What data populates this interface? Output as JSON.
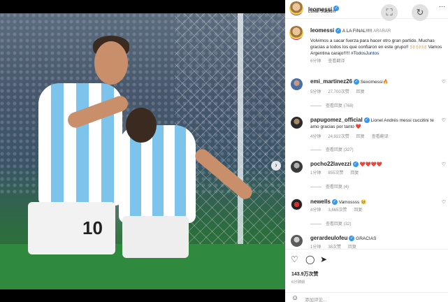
{
  "post": {
    "author": "leomessi",
    "location": "Lusail Stadium",
    "caption_head": "A LA FINAL!!!!! ",
    "caption_tag": "ARARAR",
    "caption_body": "Volvimos a sacar fuerza para hacer otro gran partido. Muchas gracias a todos los que confiaron en este grupo!! 🙌🏻🙌🏻🙌🏻 Vamos Argentina carajo!!!!! ",
    "hashtag": "#TodosJuntos",
    "caption_time": "6分钟",
    "caption_translate": "查看翻译",
    "likes": "143.9万次赞",
    "posted": "6分钟前",
    "jersey_number": "10",
    "add_comment_placeholder": "添加评论..."
  },
  "comments": [
    {
      "user": "emi_martinez26",
      "verified": true,
      "text": "Sexomessi🔥",
      "time": "5分钟",
      "likes": "27,700次赞",
      "reply": "回复",
      "view_replies": "查看回复 (768)"
    },
    {
      "user": "papugomez_official",
      "verified": true,
      "text": "Lionel Andrés messi cuccitini te amo gracias por tanto ❤️",
      "time": "4分钟",
      "likes": "24,922次赞",
      "reply": "回复",
      "translate": "查看翻译",
      "view_replies": "查看回复 (327)"
    },
    {
      "user": "pocho22lavezzi",
      "verified": true,
      "text": "❤️❤️❤️❤️",
      "time": "1分钟",
      "likes": "855次赞",
      "reply": "回复",
      "view_replies": "查看回复 (4)"
    },
    {
      "user": "newells",
      "verified": true,
      "text": "Vamossss 🥺",
      "time": "4分钟",
      "likes": "3,665次赞",
      "reply": "回复",
      "view_replies": "查看回复 (32)"
    },
    {
      "user": "gerardeulofeu",
      "verified": true,
      "text": "GRACIAS",
      "time": "1分钟",
      "likes": "38次赞",
      "reply": "回复"
    }
  ],
  "icons": {
    "more": "···",
    "screenshot": "⛶",
    "refresh": "↻",
    "next": "›",
    "heart": "♡",
    "comment": "◯",
    "share": "➤",
    "emoji": "☺"
  }
}
